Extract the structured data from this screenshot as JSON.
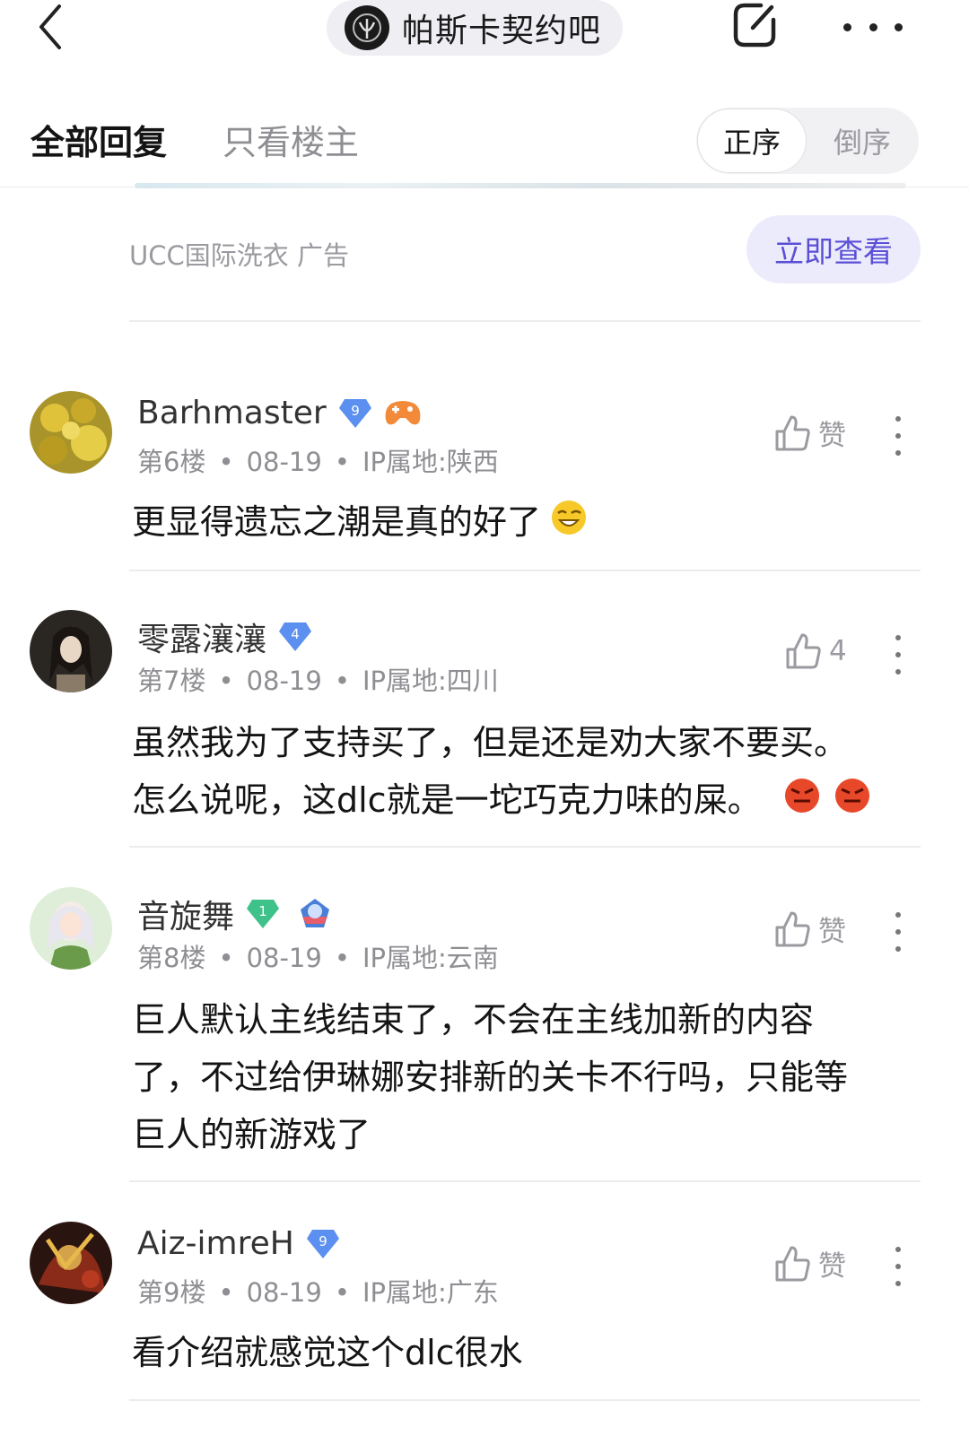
{
  "header": {
    "forum_name": "帕斯卡契约吧"
  },
  "tabs": {
    "all": "全部回复",
    "owner_only": "只看楼主",
    "sort_asc": "正序",
    "sort_desc": "倒序"
  },
  "ad": {
    "source": "UCC国际洗衣  广告",
    "button": "立即查看"
  },
  "comments": [
    {
      "username": "Barhmaster",
      "level": "9",
      "floor": "第6楼",
      "date": "08-19",
      "ip": "IP属地:陕西",
      "like_label": "赞",
      "text": "更显得遗忘之潮是真的好了"
    },
    {
      "username": "零露瀼瀼",
      "level": "4",
      "floor": "第7楼",
      "date": "08-19",
      "ip": "IP属地:四川",
      "like_label": "4",
      "text_line1": "虽然我为了支持买了，但是还是劝大家不要买。",
      "text_line2": "怎么说呢，这dlc就是一坨巧克力味的屎。"
    },
    {
      "username": "音旋舞",
      "level": "1",
      "floor": "第8楼",
      "date": "08-19",
      "ip": "IP属地:云南",
      "like_label": "赞",
      "text_line1": "巨人默认主线结束了，不会在主线加新的内容",
      "text_line2": "了，不过给伊琳娜安排新的关卡不行吗，只能等",
      "text_line3": "巨人的新游戏了"
    },
    {
      "username": "Aiz-imreH",
      "level": "9",
      "floor": "第9楼",
      "date": "08-19",
      "ip": "IP属地:广东",
      "like_label": "赞",
      "text": "看介绍就感觉这个dlc很水"
    }
  ],
  "icons": {
    "back": "chevron-left-icon",
    "edit": "edit-icon",
    "more": "more-horizontal-icon",
    "like": "thumb-up-icon",
    "menu": "more-vertical-icon"
  },
  "colors": {
    "accent": "#5a4fd6",
    "level_badge_blue": "#5b8ff0",
    "level_badge_green": "#3fc28a"
  }
}
